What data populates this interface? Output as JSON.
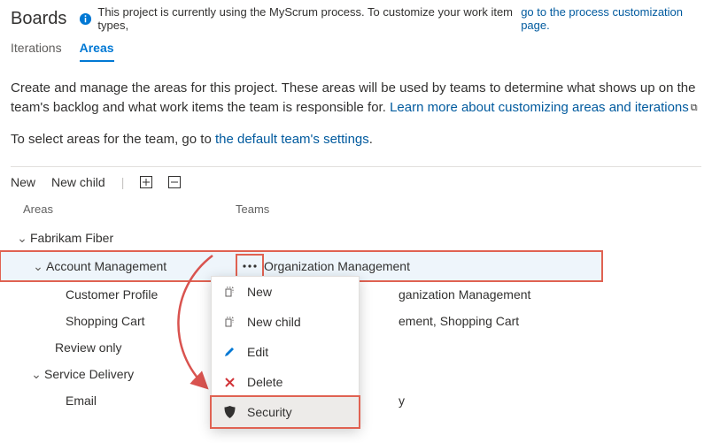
{
  "header": {
    "title": "Boards",
    "banner_text": "This project is currently using the MyScrum process. To customize your work item types, ",
    "banner_link": "go to the process customization page."
  },
  "tabs": {
    "iterations": "Iterations",
    "areas": "Areas"
  },
  "intro": {
    "line1a": "Create and manage the areas for this project. These areas will be used by teams to determine what shows up on the team's backlog and what work items the team is responsible for. ",
    "link1": "Learn more about customizing areas and iterations",
    "line2a": "To select areas for the team, go to ",
    "link2": "the default team's settings",
    "period": "."
  },
  "toolbar": {
    "new": "New",
    "new_child": "New child"
  },
  "columns": {
    "areas": "Areas",
    "teams": "Teams"
  },
  "tree": {
    "n0": {
      "label": "Fabrikam Fiber",
      "team": ""
    },
    "n1": {
      "label": "Account Management",
      "team": "Organization Management"
    },
    "n1a": {
      "label": "Customer Profile",
      "team": "ganization Management"
    },
    "n1b": {
      "label": "Shopping Cart",
      "team": "ement, Shopping Cart"
    },
    "n2": {
      "label": "Review only",
      "team": ""
    },
    "n3": {
      "label": "Service Delivery",
      "team": ""
    },
    "n3a": {
      "label": "Email",
      "team": "y"
    }
  },
  "menu": {
    "new": "New",
    "new_child": "New child",
    "edit": "Edit",
    "delete": "Delete",
    "security": "Security"
  }
}
